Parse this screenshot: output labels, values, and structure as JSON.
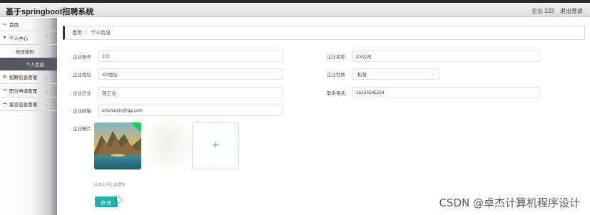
{
  "titlebar": {
    "text": ""
  },
  "header": {
    "app_title": "基于springboot招聘系统",
    "user_info": "企业 222",
    "logout_label": "退出登录"
  },
  "sidebar": {
    "items": [
      {
        "label": "首页",
        "icon": "home-icon"
      },
      {
        "label": "个人中心",
        "icon": "user-icon"
      },
      {
        "label": "修改密码"
      },
      {
        "label": "个人信息"
      },
      {
        "label": "招聘信息管理",
        "icon": "list-icon"
      },
      {
        "label": "职位申请管理",
        "icon": "grid-icon"
      },
      {
        "label": "留言信息管理",
        "icon": "grid-icon"
      }
    ]
  },
  "breadcrumb": {
    "home": "首页",
    "separator": "/",
    "current": "个人信息"
  },
  "form": {
    "account": {
      "label": "企业账号",
      "value": "222"
    },
    "name": {
      "label": "企业名称",
      "value": "XX公司"
    },
    "address": {
      "label": "企业地址",
      "value": "XX地址"
    },
    "nature": {
      "label": "企业性质",
      "value": "私营"
    },
    "industry": {
      "label": "企业行业",
      "value": "轻工业"
    },
    "phone": {
      "label": "联系电话",
      "value": "15154545254"
    },
    "email": {
      "label": "企业邮箱",
      "value": "shichanjin@qq.com"
    },
    "photo": {
      "label": "企业图片",
      "tip": "点击上传企业图片"
    },
    "submit_label": "修 改"
  },
  "watermark": "CSDN @卓杰计算机程序设计",
  "colors": {
    "accent": "#20b2aa",
    "active_nav": "#55595f",
    "success": "#13ce66"
  }
}
